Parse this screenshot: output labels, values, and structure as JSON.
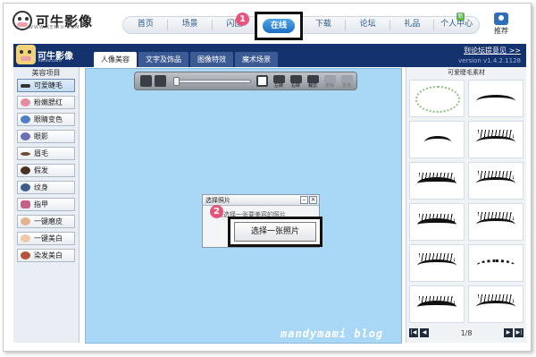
{
  "site": {
    "logo_text": "可牛影像",
    "logo_sub": "WWW.KENIU.COM",
    "nav": [
      "首页",
      "场景",
      "闪图",
      "在线",
      "下载",
      "论坛",
      "礼品",
      "个人中心"
    ],
    "nav_active_index": 3,
    "recommend_label": "推荐",
    "new_badge": "新"
  },
  "markers": [
    "1",
    "2"
  ],
  "app": {
    "logo_text": "可牛影像",
    "logo_sub": "keniu.com",
    "tabs": [
      "人像美容",
      "文字及饰品",
      "图像特效",
      "魔术场景"
    ],
    "active_tab": 0,
    "link_text": "到论坛提意见 >>",
    "version": "version v1.4.2.1128"
  },
  "left_panel": {
    "title": "美容项目",
    "tools": [
      "可爱睫毛",
      "粉嫩腮红",
      "眼睛变色",
      "眼影",
      "眉毛",
      "假发",
      "纹身",
      "指甲",
      "一键磨皮",
      "一键美白",
      "染发美白"
    ],
    "active_index": 0
  },
  "toolbar": {
    "buttons": [
      "左转",
      "右转",
      "裁剪",
      "撤销",
      "重做"
    ]
  },
  "dialog": {
    "title": "选择照片",
    "message": "请选择一张要美容的照片",
    "button": "选择一张照片"
  },
  "right_panel": {
    "title": "可爱睫毛素材",
    "page": "1/8"
  },
  "watermark": "mandymami blog",
  "colors": {
    "app_header": "#14326e",
    "canvas": "#a9d8f7",
    "marker": "#e8557c"
  }
}
